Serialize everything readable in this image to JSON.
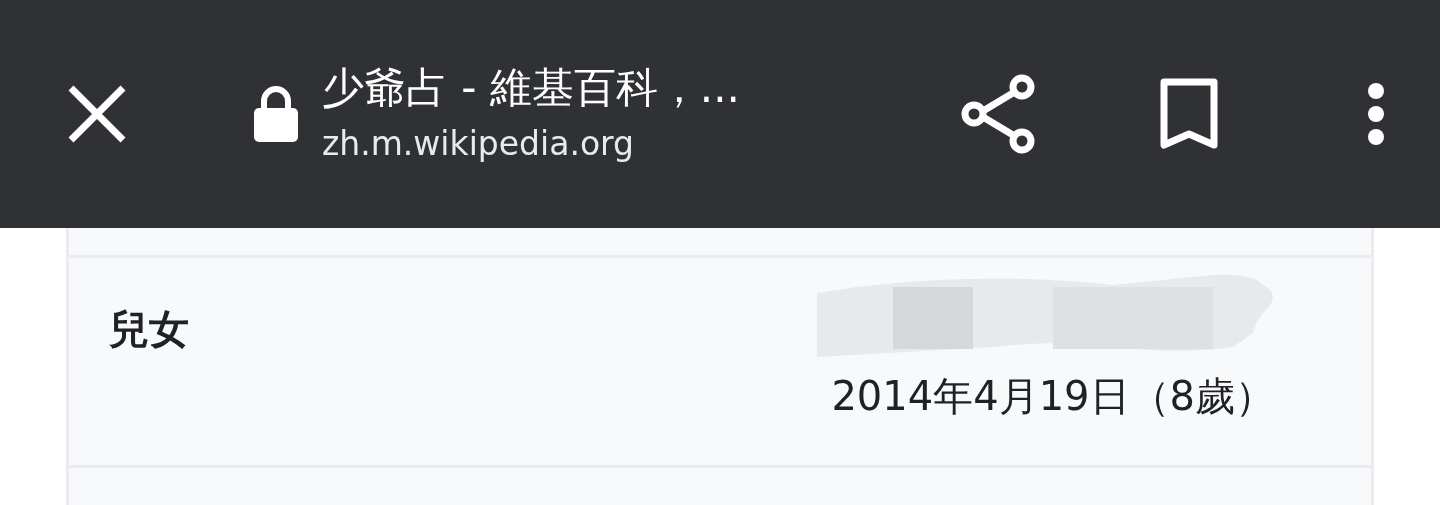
{
  "toolbar": {
    "title": "少爺占 - 維基百科，...",
    "url": "zh.m.wikipedia.org",
    "secure": true
  },
  "infobox": {
    "rows": [
      {
        "label": "兒女",
        "redacted": true,
        "value": "2014年4月19日（8歲）"
      }
    ]
  }
}
